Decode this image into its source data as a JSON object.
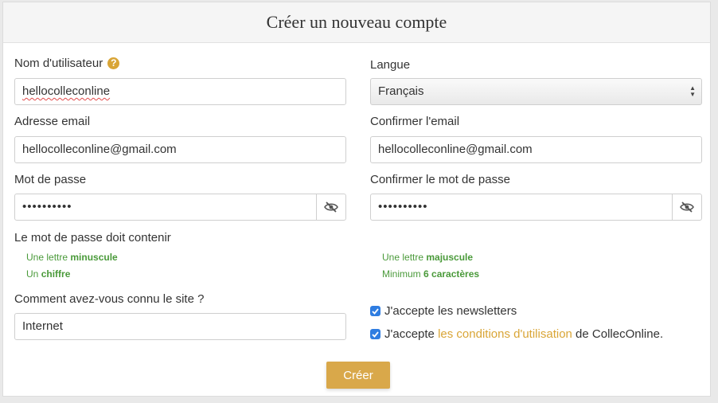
{
  "form": {
    "title": "Créer un nouveau compte",
    "username": {
      "label": "Nom d'utilisateur",
      "help_icon": "question-circle-icon",
      "value": "hellocolleconline"
    },
    "language": {
      "label": "Langue",
      "selected": "Français"
    },
    "email": {
      "label": "Adresse email",
      "value": "hellocolleconline@gmail.com"
    },
    "confirm_email": {
      "label": "Confirmer l'email",
      "value": "hellocolleconline@gmail.com"
    },
    "password": {
      "label": "Mot de passe",
      "value": "••••••••••",
      "toggle_icon": "eye-slash-icon"
    },
    "confirm_password": {
      "label": "Confirmer le mot de passe",
      "value": "••••••••••",
      "toggle_icon": "eye-slash-icon"
    },
    "password_rules": {
      "heading": "Le mot de passe doit contenir",
      "items": [
        {
          "prefix": "Une lettre",
          "strong": "minuscule"
        },
        {
          "prefix": "Une lettre",
          "strong": "majuscule"
        },
        {
          "prefix": "Un",
          "strong": "chiffre"
        },
        {
          "prefix": "Minimum",
          "strong": "6 caractères"
        }
      ]
    },
    "referral": {
      "label": "Comment avez-vous connu le site ?",
      "value": "Internet"
    },
    "newsletter": {
      "label": "J'accepte les newsletters",
      "checked": true
    },
    "terms": {
      "prefix": "J'accepte",
      "link": "les conditions d'utilisation",
      "suffix": "de CollecOnline.",
      "checked": true
    },
    "submit_label": "Créer"
  },
  "colors": {
    "accent": "#d9a536",
    "valid": "#4a9a3a",
    "checkbox": "#2f7de1"
  }
}
